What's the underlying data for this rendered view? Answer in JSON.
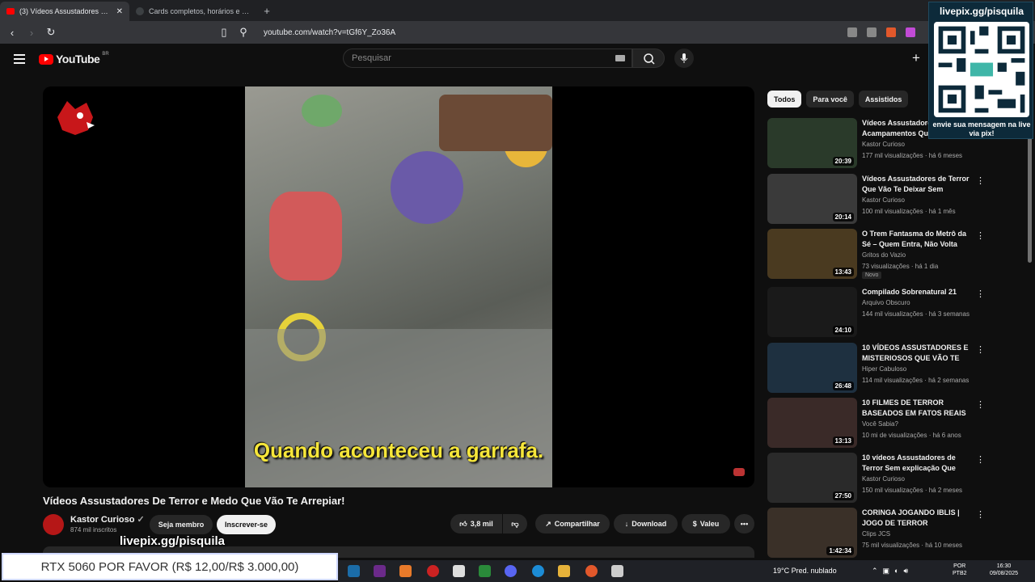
{
  "browser": {
    "tabs": [
      {
        "title": "(3) Vídeos Assustadores De T...",
        "active": true
      },
      {
        "title": "Cards completos, horários e estatísti...",
        "active": false
      }
    ],
    "url": "youtube.com/watch?v=tGf6Y_Zo36A"
  },
  "youtube": {
    "logo": "YouTube",
    "region": "BR",
    "search_placeholder": "Pesquisar"
  },
  "video": {
    "subtitle": "Quando aconteceu a garrafa.",
    "title": "Vídeos Assustadores De Terror e Medo Que Vão Te Arrepiar!",
    "channel": "Kastor Curioso",
    "subscribers": "874 mil inscritos",
    "join_label": "Seja membro",
    "subscribe_label": "Inscrever-se",
    "likes": "3,8 mil",
    "share_label": "Compartilhar",
    "download_label": "Download",
    "thanks_label": "Valeu"
  },
  "chips": [
    "Todos",
    "Para você",
    "Assistidos"
  ],
  "recommendations": [
    {
      "title": "Vídeos Assustadores de Acampamentos Que...",
      "channel": "Kastor Curioso",
      "meta": "177 mil visualizações · há 6 meses",
      "duration": "20:39",
      "badge": "",
      "thumb_color": "#2a3a2a"
    },
    {
      "title": "Vídeos Assustadores de Terror Que Vão Te Deixar Sem Dormi...",
      "channel": "Kastor Curioso",
      "meta": "100 mil visualizações · há 1 mês",
      "duration": "20:14",
      "badge": "",
      "thumb_color": "#3a3a3a"
    },
    {
      "title": "O Trem Fantasma do Metrô da Sé – Quem Entra, Não Volta",
      "channel": "Gritos do Vazio",
      "meta": "73 visualizações · há 1 dia",
      "duration": "13:43",
      "badge": "Novo",
      "thumb_color": "#4a3a20"
    },
    {
      "title": "Compilado Sobrenatural 21",
      "channel": "Arquivo Obscuro",
      "meta": "144 mil visualizações · há 3 semanas",
      "duration": "24:10",
      "badge": "",
      "thumb_color": "#1a1a1a"
    },
    {
      "title": "10 VÍDEOS ASSUSTADORES E MISTERIOSOS QUE VÃO TE D...",
      "channel": "Hiper Cabuloso",
      "meta": "114 mil visualizações · há 2 semanas",
      "duration": "26:48",
      "badge": "",
      "thumb_color": "#1e3040"
    },
    {
      "title": "10 FILMES DE TERROR BASEADOS EM FATOS REAIS",
      "channel": "Você Sabia?",
      "meta": "10 mi de visualizações · há 6 anos",
      "duration": "13:13",
      "badge": "",
      "thumb_color": "#3a2a28"
    },
    {
      "title": "10 vídeos Assustadores de Terror Sem explicação Que Sã...",
      "channel": "Kastor Curioso",
      "meta": "150 mil visualizações · há 2 meses",
      "duration": "27:50",
      "badge": "",
      "thumb_color": "#2a2a2a"
    },
    {
      "title": "CORINGA JOGANDO IBLIS | JOGO DE TERROR",
      "channel": "Clips JCS",
      "meta": "75 mil visualizações · há 10 meses",
      "duration": "1:42:34",
      "badge": "",
      "thumb_color": "#3a3028"
    }
  ],
  "overlay": {
    "qr_title": "livepix.gg/pisquila",
    "qr_caption": "envie sua mensagem na live via pix!",
    "livepix_text": "livepix.gg/pisquila",
    "tts_message": "RTX 5060 POR FAVOR (R$ 12,00/R$ 3.000,00)"
  },
  "taskbar": {
    "weather": "19°C  Pred. nublado",
    "lang_1": "POR",
    "lang_2": "PTB2",
    "time": "16:30",
    "date": "09/08/2025"
  }
}
